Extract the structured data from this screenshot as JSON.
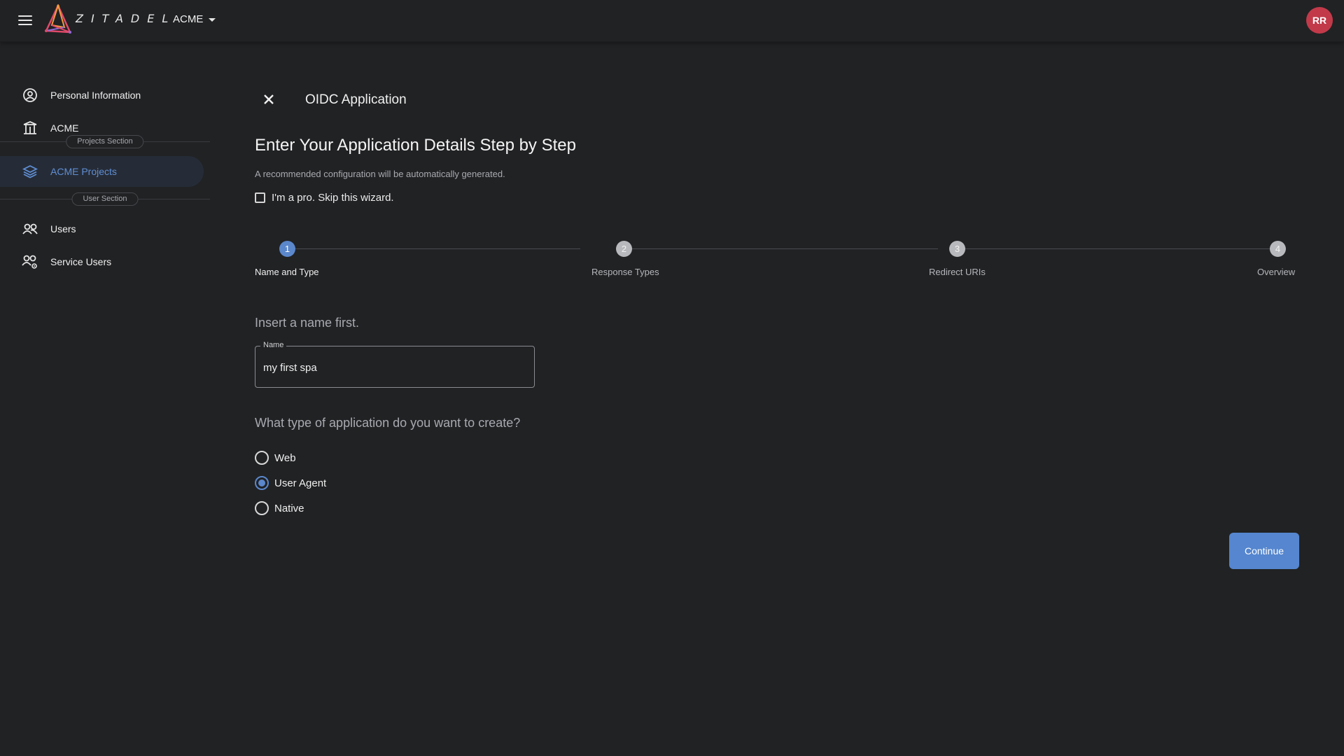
{
  "header": {
    "brand": "ZITADEL",
    "org_name": "ACME",
    "avatar_initials": "RR",
    "avatar_color": "#c23a4a"
  },
  "sidebar": {
    "items": [
      {
        "label": "Personal Information",
        "icon": "person-circle-icon"
      },
      {
        "label": "ACME",
        "icon": "building-icon"
      },
      {
        "label": "ACME Projects",
        "icon": "layers-icon",
        "active": true
      },
      {
        "label": "Users",
        "icon": "users-icon"
      },
      {
        "label": "Service Users",
        "icon": "service-users-icon"
      }
    ],
    "sections": [
      "Projects Section",
      "User Section"
    ]
  },
  "main": {
    "app_title": "OIDC Application",
    "heading": "Enter Your Application Details Step by Step",
    "subtext": "A recommended configuration will be automatically generated.",
    "pro_checkbox_label": "I'm a pro. Skip this wizard.",
    "steps": [
      {
        "number": "1",
        "label": "Name and Type",
        "active": true
      },
      {
        "number": "2",
        "label": "Response Types"
      },
      {
        "number": "3",
        "label": "Redirect URIs"
      },
      {
        "number": "4",
        "label": "Overview"
      }
    ],
    "name_prompt": "Insert a name first.",
    "name_field": {
      "label": "Name",
      "value": "my first spa"
    },
    "type_prompt": "What type of application do you want to create?",
    "app_types": [
      {
        "label": "Web",
        "selected": false
      },
      {
        "label": "User Agent",
        "selected": true
      },
      {
        "label": "Native",
        "selected": false
      }
    ],
    "continue_label": "Continue"
  },
  "colors": {
    "accent": "#5b87cc",
    "background": "#212224",
    "active_nav_bg": "#262c37"
  }
}
